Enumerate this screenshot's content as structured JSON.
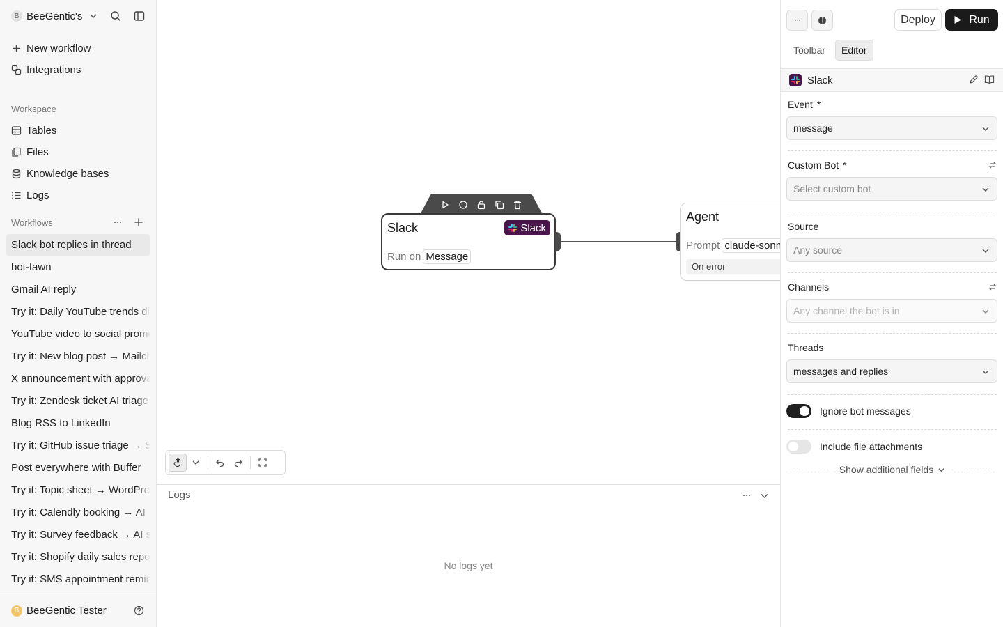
{
  "workspace": {
    "initial": "B",
    "name": "BeeGentic's"
  },
  "nav": {
    "new_workflow": "New workflow",
    "integrations": "Integrations"
  },
  "workspace_section": {
    "label": "Workspace",
    "items": [
      "Tables",
      "Files",
      "Knowledge bases",
      "Logs"
    ]
  },
  "workflows": {
    "label": "Workflows",
    "items": [
      "Slack bot replies in thread",
      "bot-fawn",
      "Gmail AI reply",
      "Try it: Daily YouTube trends digest",
      "YouTube video to social promo",
      "Try it: New blog post → Mailchimp",
      "X announcement with approval",
      "Try it: Zendesk ticket AI triage",
      "Blog RSS to LinkedIn",
      "Try it: GitHub issue triage → Slack",
      "Post everywhere with Buffer",
      "Try it: Topic sheet → WordPress",
      "Try it: Calendly booking → AI",
      "Try it: Survey feedback → AI summary",
      "Try it: Shopify daily sales report",
      "Try it: SMS appointment reminder"
    ]
  },
  "user": {
    "initial": "B",
    "name": "BeeGentic Tester"
  },
  "canvas": {
    "slack_node": {
      "title": "Slack",
      "tag": "Slack",
      "run_on_label": "Run on",
      "run_on_value": "Message"
    },
    "agent_node": {
      "title": "Agent",
      "prompt_label": "Prompt",
      "prompt_value": "claude-sonnet",
      "on_error": "On error"
    }
  },
  "logs": {
    "title": "Logs",
    "empty": "No logs yet"
  },
  "panel": {
    "more_label": "···",
    "deploy": "Deploy",
    "run": "Run",
    "tabs": [
      "Toolbar",
      "Editor"
    ],
    "block_name": "Slack",
    "fields": {
      "event": {
        "label": "Event",
        "required": "*",
        "value": "message"
      },
      "custom_bot": {
        "label": "Custom Bot",
        "required": "*",
        "placeholder": "Select custom bot"
      },
      "source": {
        "label": "Source",
        "placeholder": "Any source"
      },
      "channels": {
        "label": "Channels",
        "placeholder": "Any channel the bot is in"
      },
      "threads": {
        "label": "Threads",
        "value": "messages and replies"
      }
    },
    "toggles": {
      "ignore_bot": {
        "label": "Ignore bot messages",
        "on": true
      },
      "include_files": {
        "label": "Include file attachments",
        "on": false
      }
    },
    "show_more": "Show additional fields"
  },
  "colors": {
    "slack_purple": "#4a154b",
    "run_button": "#1a1a1a"
  }
}
